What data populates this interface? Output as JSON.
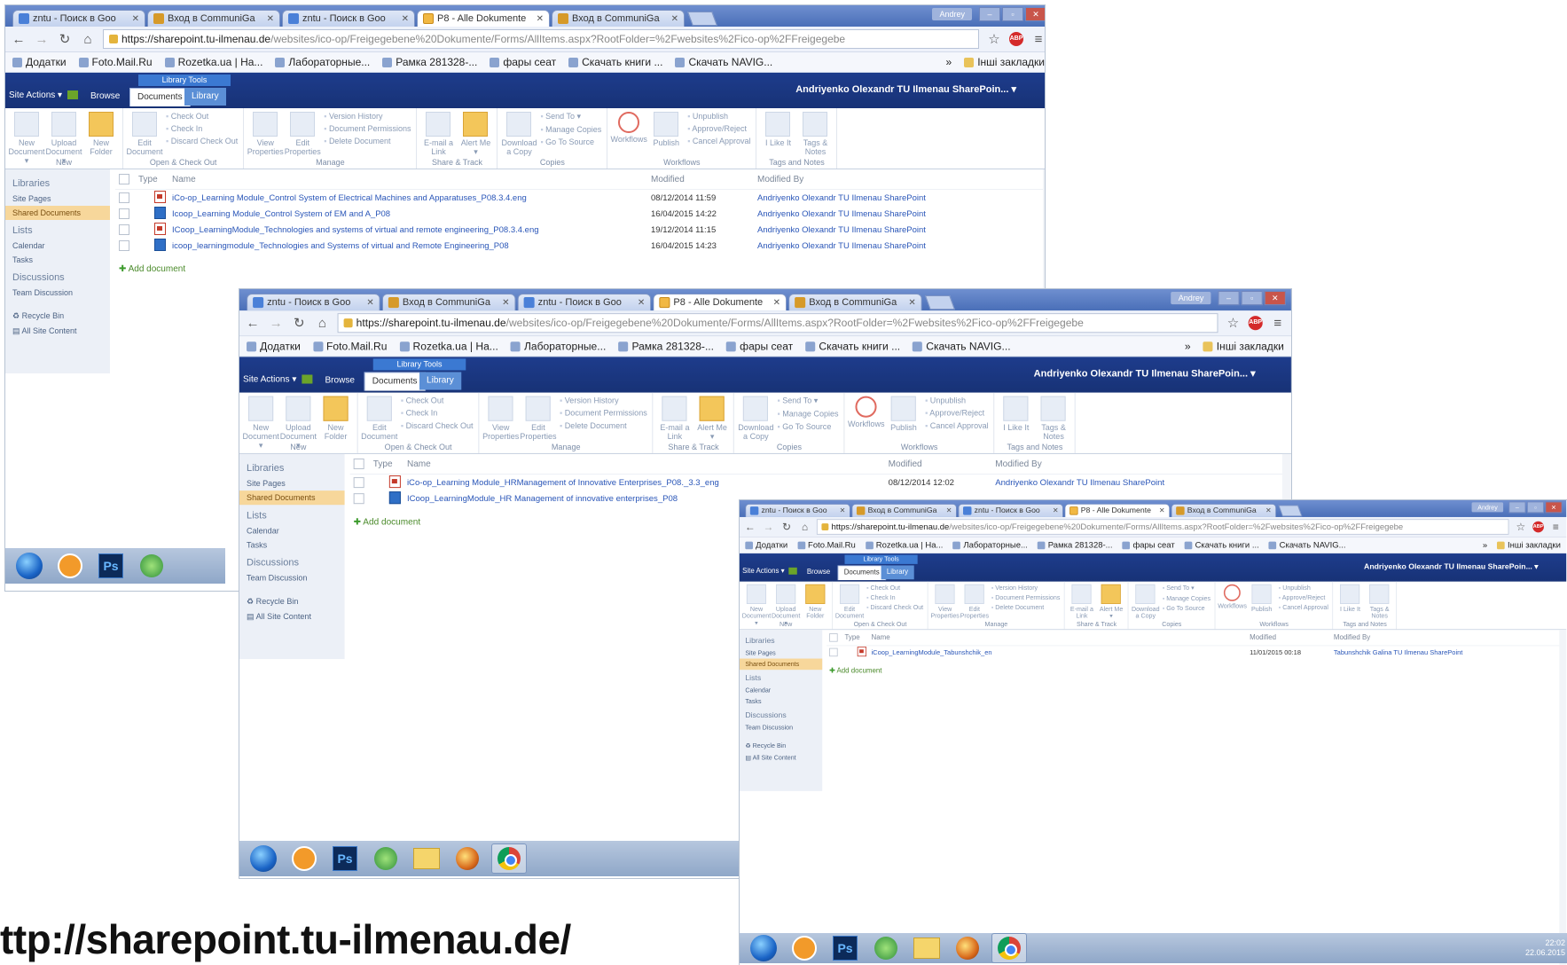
{
  "browser": {
    "tabs": [
      {
        "label": "zntu - Поиск в Goo",
        "icon": "google-icon",
        "active": false
      },
      {
        "label": "Вход в CommuniGa",
        "icon": "communigate-icon",
        "active": false
      },
      {
        "label": "zntu - Поиск в Goo",
        "icon": "google-icon",
        "active": false
      },
      {
        "label": "P8 - Alle Dokumente",
        "icon": "sharepoint-icon",
        "active": true
      },
      {
        "label": "Вход в CommuniGa",
        "icon": "communigate-icon",
        "active": false
      }
    ],
    "user_badge": "Andrey",
    "address_host": "https://sharepoint.tu-ilmenau.de",
    "address_path": "/websites/ico-op/Freigegebene%20Dokumente/Forms/AllItems.aspx?RootFolder=%2Fwebsites%2Fico-op%2FFreigegebe",
    "bookmarks": [
      "Додатки",
      "Foto.Mail.Ru",
      "Rozetka.ua | На...",
      "Лабораторные...",
      "Рамка 281328-...",
      "фары сеат",
      "Скачать книги ...",
      "Скачать NAVIG..."
    ],
    "bookmarks_more": "»",
    "other_bookmarks": "Інші закладки"
  },
  "sharepoint": {
    "library_tools": "Library Tools",
    "site_actions": "Site Actions ▾",
    "tabs": {
      "browse": "Browse",
      "documents": "Documents",
      "library": "Library"
    },
    "user": "Andriyenko Olexandr TU Ilmenau SharePoin... ▾",
    "ribbon": {
      "new": {
        "label": "New",
        "buttons": [
          "New Document ▾",
          "Upload Document ▾",
          "New Folder"
        ]
      },
      "open": {
        "label": "Open & Check Out",
        "big": "Edit Document",
        "small": [
          "Check Out",
          "Check In",
          "Discard Check Out"
        ]
      },
      "manage": {
        "label": "Manage",
        "big": [
          "View Properties",
          "Edit Properties"
        ],
        "small": [
          "Version History",
          "Document Permissions",
          "Delete Document"
        ]
      },
      "share": {
        "label": "Share & Track",
        "big": [
          "E-mail a Link",
          "Alert Me ▾"
        ]
      },
      "copies": {
        "label": "Copies",
        "big": "Download a Copy",
        "small": [
          "Send To ▾",
          "Manage Copies",
          "Go To Source"
        ]
      },
      "workflows": {
        "label": "Workflows",
        "big": [
          "Workflows",
          "Publish"
        ],
        "small": [
          "Unpublish",
          "Approve/Reject",
          "Cancel Approval"
        ]
      },
      "tags": {
        "label": "Tags and Notes",
        "big": [
          "I Like It",
          "Tags & Notes"
        ]
      }
    },
    "quick_launch": {
      "libraries_heading": "Libraries",
      "libraries": [
        "Site Pages",
        "Shared Documents"
      ],
      "lists_heading": "Lists",
      "lists": [
        "Calendar",
        "Tasks"
      ],
      "discussions_heading": "Discussions",
      "discussions": [
        "Team Discussion"
      ],
      "recycle": "Recycle Bin",
      "all_content": "All Site Content"
    },
    "columns": {
      "type": "Type",
      "name": "Name",
      "modified": "Modified",
      "modified_by": "Modified By"
    },
    "add_document": "Add document"
  },
  "window1": {
    "documents": [
      {
        "type": "pdf",
        "name": "iCo-op_Learning Module_Control System of Electrical Machines and Apparatuses_P08.3.4.eng",
        "modified": "08/12/2014 11:59",
        "modified_by": "Andriyenko Olexandr TU Ilmenau SharePoint"
      },
      {
        "type": "doc",
        "name": "Icoop_Learning Module_Control System of EM and A_P08",
        "modified": "16/04/2015 14:22",
        "modified_by": "Andriyenko Olexandr TU Ilmenau SharePoint"
      },
      {
        "type": "pdf",
        "name": "ICoop_LearningModule_Technologies and systems of virtual and remote engineering_P08.3.4.eng",
        "modified": "19/12/2014 11:15",
        "modified_by": "Andriyenko Olexandr TU Ilmenau SharePoint"
      },
      {
        "type": "doc",
        "name": "icoop_learningmodule_Technologies and Systems of virtual and Remote Engineering_P08",
        "modified": "16/04/2015 14:23",
        "modified_by": "Andriyenko Olexandr TU Ilmenau SharePoint"
      }
    ]
  },
  "window2": {
    "documents": [
      {
        "type": "pdf",
        "name": "iCo-op_Learning Module_HRManagement of Innovative Enterprises_P08._3.3_eng",
        "modified": "08/12/2014 12:02",
        "modified_by": "Andriyenko Olexandr TU Ilmenau SharePoint"
      },
      {
        "type": "doc",
        "name": "ICoop_LearningModule_HR Management of innovative enterprises_P08",
        "modified": "",
        "modified_by": ""
      }
    ]
  },
  "window3": {
    "documents": [
      {
        "type": "pdf",
        "name": "iCoop_LearningModule_Tabunshchik_en",
        "modified": "11/01/2015 00:18",
        "modified_by": "Tabunshchik Galina TU Ilmenau SharePoint"
      }
    ],
    "clock_time": "22:02",
    "clock_date": "22.06.2015"
  },
  "caption": "ttp://sharepoint.tu-ilmenau.de/",
  "colors": {
    "sharepoint_bar": "#1e3c8c",
    "selected_nav": "#f7d79b",
    "link": "#2a56b8"
  }
}
